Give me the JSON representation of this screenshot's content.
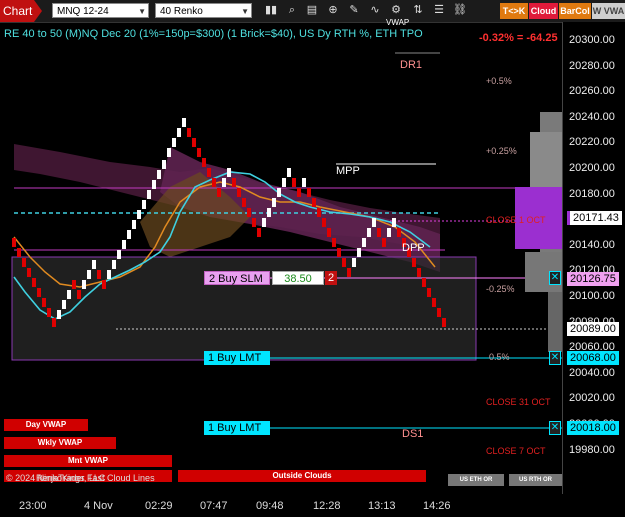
{
  "toolbar": {
    "tab": "Chart",
    "symbol": "MNQ 12-24",
    "bar_type": "40 Renko",
    "tk_label": "T<>K",
    "cloud_label": "Cloud",
    "barcol_label": "BarCol",
    "vwa_label": "W VWA",
    "icons": [
      "bar-chart-icon",
      "magnifier-icon",
      "template-icon",
      "crosshair-icon",
      "pencil-icon",
      "indicators-icon",
      "strategies-icon",
      "chart-trader-icon",
      "properties-icon",
      "link-icon"
    ]
  },
  "chart": {
    "header": "RE 40 to 50 (M)NQ Dec 20 (1%=150p=$300) (1 Brick=$40), US Dy RTH %, ETH TPO",
    "change_text": "-0.32% = -64.25",
    "top_fragment": "VWAP",
    "pivot_labels": {
      "dr1": "DR1",
      "mpp": "MPP",
      "dpp": "DPP",
      "ds1": "DS1"
    },
    "pct_labels": [
      "+0.5%",
      "+0.25%",
      "-0.25%",
      "0.5%"
    ],
    "close_labels": {
      "close_prev": "CLOSE 1 OCT",
      "close_31": "CLOSE 31 OCT",
      "close_7": "CLOSE 7 OCT"
    },
    "orders": {
      "buy_slm": {
        "label": "2 Buy SLM",
        "price": "38.50",
        "qty": "2"
      },
      "buy_lmt_1": {
        "label": "1 Buy LMT"
      },
      "buy_lmt_2": {
        "label": "1 Buy LMT"
      }
    },
    "bottom_boxes": {
      "day_vwap": "Day VWAP",
      "wkly_vwap": "Wkly VWAP",
      "mnt_vwap": "Mnt VWAP",
      "outside_clouds": "Outside Clouds",
      "us_eth": "US ETH OR",
      "us_rth": "US RTH OR"
    },
    "copyright": "© 2024 NinjaTrader, LLC",
    "copyright_overlay": "RenkoKings Fast Cloud Lines",
    "colors": {
      "up_brick": "#ffffff",
      "down_brick": "#e00000",
      "vwap": "#3fd0e0",
      "cloud": "#6a2a4a",
      "order_box": "#00e5ff"
    }
  },
  "price_axis": {
    "labels": [
      "20300.00",
      "20280.00",
      "20260.00",
      "20240.00",
      "20220.00",
      "20200.00",
      "20180.00",
      "20160.00",
      "20140.00",
      "20120.00",
      "20100.00",
      "20080.00",
      "20060.00",
      "20040.00",
      "20020.00",
      "20000.00",
      "19980.00"
    ],
    "markers": {
      "p1": "20171.43",
      "p2": "20126.75",
      "current": "20089.00",
      "p3": "20068.00",
      "p4": "20018.00"
    }
  },
  "time_axis": [
    "23:00",
    "4 Nov",
    "02:29",
    "07:47",
    "09:48",
    "12:28",
    "13:13",
    "14:26"
  ]
}
